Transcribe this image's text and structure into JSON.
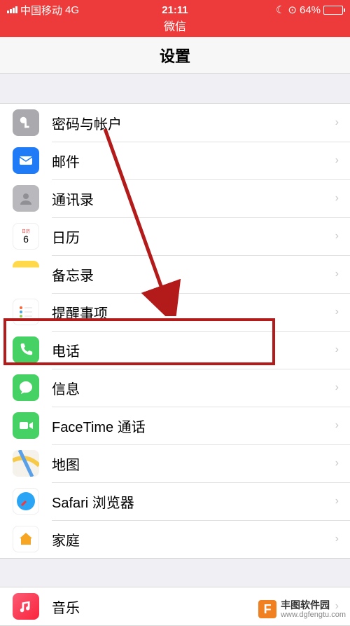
{
  "status": {
    "carrier": "中国移动",
    "network": "4G",
    "time": "21:11",
    "battery_pct": "64%"
  },
  "wechat_label": "微信",
  "nav": {
    "title": "设置"
  },
  "groups": [
    {
      "rows": [
        {
          "icon": "passwords",
          "label": "密码与帐户"
        },
        {
          "icon": "mail",
          "label": "邮件"
        },
        {
          "icon": "contacts",
          "label": "通讯录"
        },
        {
          "icon": "calendar",
          "label": "日历"
        },
        {
          "icon": "notes",
          "label": "备忘录"
        },
        {
          "icon": "reminders",
          "label": "提醒事项"
        },
        {
          "icon": "phone",
          "label": "电话"
        },
        {
          "icon": "messages",
          "label": "信息"
        },
        {
          "icon": "facetime",
          "label": "FaceTime 通话"
        },
        {
          "icon": "maps",
          "label": "地图"
        },
        {
          "icon": "safari",
          "label": "Safari 浏览器"
        },
        {
          "icon": "home",
          "label": "家庭"
        }
      ]
    },
    {
      "rows": [
        {
          "icon": "music",
          "label": "音乐"
        }
      ]
    }
  ],
  "watermark": {
    "logo": "F",
    "name": "丰图软件园",
    "url": "www.dgfengtu.com"
  },
  "annotation": {
    "highlighted_row_label": "电话"
  }
}
